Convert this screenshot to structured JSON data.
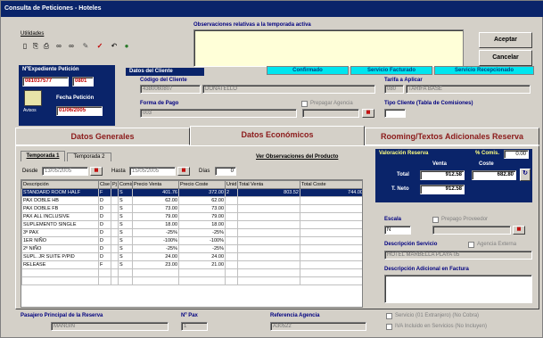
{
  "window": {
    "title": "Consulta de Peticiones - Hoteles"
  },
  "toolbar": {
    "label": "Utilidades",
    "icons": [
      "file-icon",
      "copy-icon",
      "print-icon",
      "binoculars-icon",
      "binoculars-icon",
      "tool-icon",
      "check-icon",
      "undo-icon",
      "globe-icon"
    ]
  },
  "observaciones": {
    "label": "Observaciones relativas a la temporada activa",
    "value": ""
  },
  "buttons": {
    "aceptar": "Aceptar",
    "cancelar": "Cancelar"
  },
  "expediente": {
    "label": "NºExpediente Petición",
    "number": "081037577",
    "sub": "0801",
    "fecha_label": "Fecha Petición",
    "fecha": "01/06/2005",
    "icon_label": "Avisos"
  },
  "cliente": {
    "header": "Datos del Cliente",
    "codigo_label": "Código del Cliente",
    "codigo": "4380060807",
    "nombre": "DONATELLO",
    "forma_pago_label": "Forma de Pago",
    "forma_pago": "003",
    "prepagar_label": "Prepagar Agencia",
    "tarifa_label": "Tarifa a Aplicar",
    "tarifa_code": "080",
    "tarifa_name": "TARIFA BASE",
    "tipo_cliente_label": "Tipo Cliente (Tabla de Comisiones)",
    "tipo_cliente": ""
  },
  "status": {
    "confirmado": "Confirmado",
    "facturado": "Servicio Facturado",
    "recepcionado": "Servicio Recepcionado"
  },
  "tabs": {
    "generales": "Datos Generales",
    "economicos": "Datos Económicos",
    "rooming": "Rooming/Textos Adicionales Reserva"
  },
  "temporadas": {
    "t1": "Temporada 1",
    "t2": "Temporada 2"
  },
  "periodo": {
    "desde_label": "Desde",
    "desde": "13/05/2005",
    "hasta_label": "Hasta",
    "hasta": "15/05/2005",
    "dias_label": "Días",
    "dias": "0"
  },
  "ver_observaciones": "Ver Observaciones del Producto",
  "grid": {
    "headers": [
      "Descripción",
      "Clse",
      "Pj",
      "Comis",
      "Precio Venta",
      "Precio Coste",
      "Unid",
      "Total Venta",
      "Total Coste"
    ],
    "rows": [
      [
        "STANDARD ROOM HALF",
        "F",
        "",
        "S",
        "401.76",
        "372.00",
        "2",
        "803.52",
        "744.00"
      ],
      [
        "PAX DOBLE HB",
        "D",
        "",
        "S",
        "62.00",
        "62.00",
        "",
        "",
        ""
      ],
      [
        "PAX DOBLE FB",
        "D",
        "",
        "S",
        "73.00",
        "73.00",
        "",
        "",
        ""
      ],
      [
        "PAX ALL INCLUSIVE",
        "D",
        "",
        "S",
        "79.00",
        "79.00",
        "",
        "",
        ""
      ],
      [
        "SUPLEMENTO SINGLE",
        "D",
        "",
        "S",
        "18.00",
        "18.00",
        "",
        "",
        ""
      ],
      [
        "3ª PAX",
        "D",
        "",
        "S",
        "-25%",
        "-25%",
        "",
        "",
        ""
      ],
      [
        "1ER NIÑO",
        "D",
        "",
        "S",
        "-100%",
        "-100%",
        "",
        "",
        ""
      ],
      [
        "2º NIÑO",
        "D",
        "",
        "S",
        "-25%",
        "-25%",
        "",
        "",
        ""
      ],
      [
        "SUPL. JR SUITE P/PID",
        "D",
        "",
        "S",
        "24.00",
        "24.00",
        "",
        "",
        ""
      ],
      [
        "RELEASE",
        "F",
        "",
        "S",
        "23.00",
        "21.00",
        "",
        "",
        ""
      ],
      [
        "",
        "",
        "",
        "",
        "",
        "",
        "",
        "",
        ""
      ],
      [
        "",
        "",
        "",
        "",
        "",
        "",
        "",
        "",
        ""
      ]
    ]
  },
  "valoracion": {
    "header": "Valoración Reserva",
    "comis_label": "% Comis.",
    "comis": "0.00",
    "venta_label": "Venta",
    "coste_label": "Coste",
    "total_label": "Total",
    "total_venta": "912.58",
    "total_coste": "682.80",
    "neto_label": "T. Neto",
    "neto": "912.58"
  },
  "servicio": {
    "escala_label": "Escala",
    "escala": "N",
    "prepago_label": "Prepago Proveedor",
    "desc_label": "Descripción Servicio",
    "agencia_label": "Agencia Externa",
    "desc": "HOTEL MARBELLA PLAYA 05",
    "adicional_label": "Descripción Adicional en Factura",
    "adicional": "",
    "check1": "Servicio (01 Extranjero) (No Cobra)",
    "check2": "IVA Incluido en Servicios (No Incluyen)"
  },
  "bottom": {
    "pasajero_label": "Pasajero Principal de la Reserva",
    "pasajero": "MANGIN",
    "npax_label": "Nº Pax",
    "npax": "1",
    "referencia_label": "Referencia Agencia",
    "referencia": "A30522"
  },
  "colors": {
    "title_bg": "#0a246a",
    "tab_text": "#8b1a1a",
    "status_bg": "#00e5ef",
    "field_red": "#c00000"
  }
}
